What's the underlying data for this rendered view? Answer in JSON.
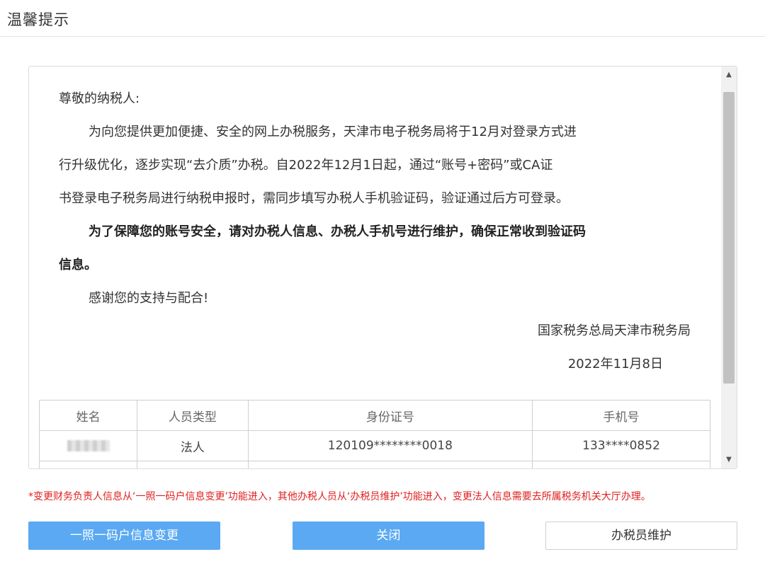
{
  "dialog": {
    "title": "温馨提示"
  },
  "letter": {
    "greeting": "尊敬的纳税人:",
    "para1_line1": "为向您提供更加便捷、安全的网上办税服务，天津市电子税务局将于12月对登录方式进",
    "para1_line2": "行升级优化，逐步实现“去介质”办税。自2022年12月1日起，通过“账号+密码”或CA证",
    "para1_line3": "书登录电子税务局进行纳税申报时，需同步填写办税人手机验证码，验证通过后方可登录。",
    "bold_line1": "为了保障您的账号安全，请对办税人信息、办税人手机号进行维护，确保正常收到验证码",
    "bold_line2": "信息。",
    "thanks": "感谢您的支持与配合!",
    "signature": "国家税务总局天津市税务局",
    "date": "2022年11月8日"
  },
  "table": {
    "headers": [
      "姓名",
      "人员类型",
      "身份证号",
      "手机号"
    ],
    "rows": [
      {
        "type": "法人",
        "id_number": "120109********0018",
        "phone": "133****0852"
      }
    ]
  },
  "notice": "*变更财务负责人信息从‘一照一码户信息变更’功能进入，其他办税人员从‘办税员维护’功能进入，变更法人信息需要去所属税务机关大厅办理。",
  "buttons": {
    "change_info": "一照一码户信息变更",
    "close": "关闭",
    "maintain": "办税员维护"
  },
  "colors": {
    "primary": "#5aa9f2",
    "notice": "#e02020"
  }
}
